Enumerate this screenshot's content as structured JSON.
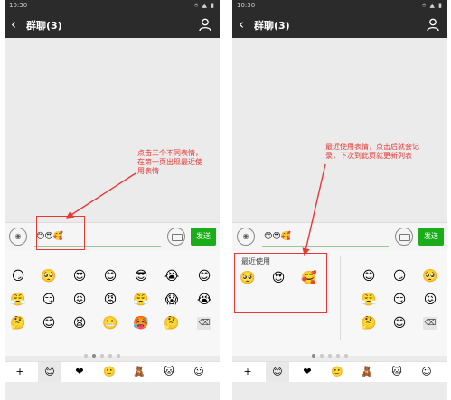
{
  "status": {
    "time": "10:30",
    "icons": "⌾ ▲ ▮"
  },
  "chat": {
    "back_icon": "chevron-left-icon",
    "title": "群聊(3)",
    "members_icon": "person-icon"
  },
  "input": {
    "voice_icon": "voice-icon",
    "text_left": "😊😍🥰",
    "text_right": "😊😍🥰",
    "keyboard_icon": "keyboard-icon",
    "send": "发送"
  },
  "left_emojis": [
    [
      "😏",
      "🥺",
      "😍",
      "😊",
      "😎",
      "😭",
      "😊"
    ],
    [
      "😤",
      "😏",
      "😖",
      "😡",
      "😤",
      "😱",
      "😭"
    ],
    [
      "🤔",
      "😊",
      "😫",
      "😬",
      "🥵",
      "🤔",
      "⌫"
    ]
  ],
  "right_recent": {
    "label": "最近使用",
    "emojis": [
      "🥺",
      "😍",
      "🥰"
    ]
  },
  "right_emojis": [
    [
      "😊",
      "😏",
      "🥺"
    ],
    [
      "😤",
      "😏",
      "😖"
    ],
    [
      "🤔",
      "😊",
      "⌫"
    ]
  ],
  "tabs": [
    "+",
    "😊",
    "❤",
    "🙂",
    "🧸",
    "🐱",
    "☺"
  ],
  "annotations": {
    "left": "点击三个不同表情，\n在第一页出现最近使\n用表情",
    "right": "最近使用表情，点击后就会记\n录，下次到此页就更新列表"
  },
  "colors": {
    "titlebar": "#2b2b2b",
    "send": "#1aad19",
    "annotation": "#e53935"
  }
}
